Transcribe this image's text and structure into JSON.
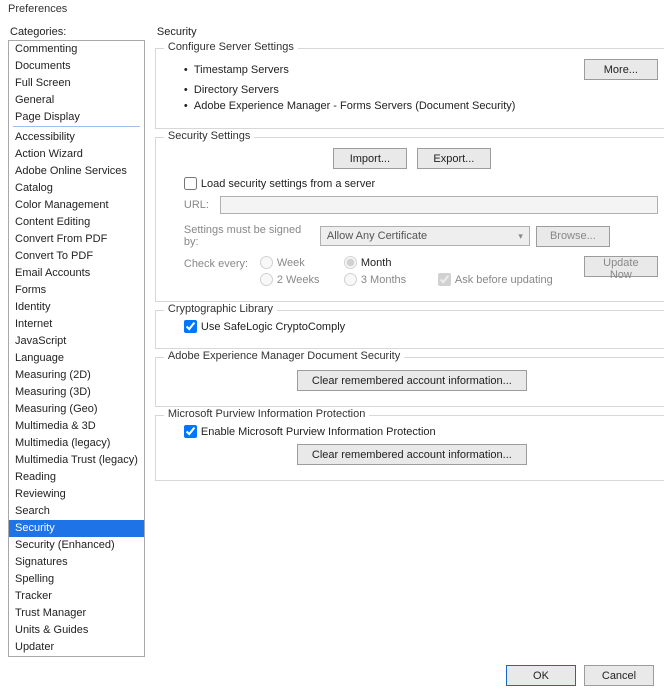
{
  "window": {
    "title": "Preferences"
  },
  "sidebar": {
    "label": "Categories:",
    "group1": [
      "Commenting",
      "Documents",
      "Full Screen",
      "General",
      "Page Display"
    ],
    "group2": [
      "Accessibility",
      "Action Wizard",
      "Adobe Online Services",
      "Catalog",
      "Color Management",
      "Content Editing",
      "Convert From PDF",
      "Convert To PDF",
      "Email Accounts",
      "Forms",
      "Identity",
      "Internet",
      "JavaScript",
      "Language",
      "Measuring (2D)",
      "Measuring (3D)",
      "Measuring (Geo)",
      "Multimedia & 3D",
      "Multimedia (legacy)",
      "Multimedia Trust (legacy)",
      "Reading",
      "Reviewing",
      "Search",
      "Security",
      "Security (Enhanced)",
      "Signatures",
      "Spelling",
      "Tracker",
      "Trust Manager",
      "Units & Guides",
      "Updater"
    ],
    "selected": "Security"
  },
  "panel": {
    "title": "Security",
    "server": {
      "legend": "Configure Server Settings",
      "items": [
        "Timestamp Servers",
        "Directory Servers",
        "Adobe Experience Manager - Forms Servers (Document Security)"
      ],
      "more": "More..."
    },
    "settings": {
      "legend": "Security Settings",
      "import": "Import...",
      "export": "Export...",
      "load_label": "Load security settings from a server",
      "load_checked": false,
      "url_label": "URL:",
      "url_value": "",
      "signed_label": "Settings must be signed by:",
      "signed_value": "Allow Any Certificate",
      "browse": "Browse...",
      "check_label": "Check every:",
      "radios": {
        "week": "Week",
        "month": "Month",
        "twoweeks": "2 Weeks",
        "threemonths": "3 Months"
      },
      "radio_selected": "month",
      "ask_label": "Ask before updating",
      "ask_checked": true,
      "update_now": "Update Now"
    },
    "crypto": {
      "legend": "Cryptographic Library",
      "use_label": "Use SafeLogic CryptoComply",
      "use_checked": true
    },
    "aem": {
      "legend": "Adobe Experience Manager Document Security",
      "clear": "Clear remembered account information..."
    },
    "purview": {
      "legend": "Microsoft Purview Information Protection",
      "enable_label": "Enable Microsoft Purview Information Protection",
      "enable_checked": true,
      "clear": "Clear remembered account information..."
    }
  },
  "footer": {
    "ok": "OK",
    "cancel": "Cancel"
  }
}
